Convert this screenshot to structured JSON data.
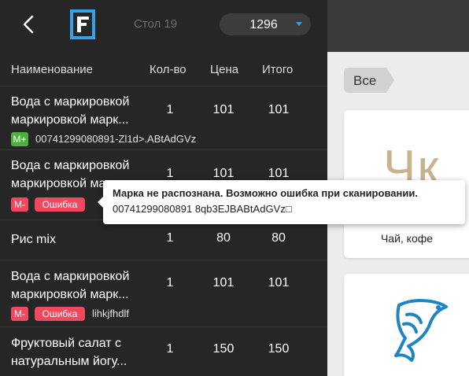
{
  "header": {
    "table_label": "Стол 19",
    "order_number": "1296"
  },
  "columns": {
    "name": "Наименование",
    "qty": "Кол-во",
    "price": "Цена",
    "total": "Итого"
  },
  "items": [
    {
      "name_line1": "Вода с маркировкой",
      "name_line2": "маркировкой марк...",
      "qty": "1",
      "price": "101",
      "total": "101",
      "mark_label": "M+",
      "code": "00741299080891-Zl1d>.ABtAdGVz"
    },
    {
      "name_line1": "Вода с маркировкой",
      "name_line2": "маркировкой марк...",
      "qty": "1",
      "price": "101",
      "total": "101",
      "mark_label": "M-",
      "error_label": "Ошибка"
    },
    {
      "name_line1": "Рис mix",
      "qty": "1",
      "price": "80",
      "total": "80"
    },
    {
      "name_line1": "Вода с маркировкой",
      "name_line2": "маркировкой марк...",
      "qty": "1",
      "price": "101",
      "total": "101",
      "mark_label": "M-",
      "error_label": "Ошибка",
      "code": "lihkjfhdlf"
    },
    {
      "name_line1": "Фруктовый салат с",
      "name_line2": "натуральным йогу...",
      "qty": "1",
      "price": "150",
      "total": "150"
    }
  ],
  "tooltip": {
    "title": "Марка не распознана. Возможно ошибка при сканировании.",
    "code": "00741299080891 8qb3EJBABtAdGVz□"
  },
  "catalog": {
    "category_tab": "Все",
    "cards": [
      {
        "letters": "Чк",
        "label": "Чай, кофе"
      },
      {
        "icon": "fish-icon"
      }
    ]
  },
  "colors": {
    "mark_ok": "#4caf3e",
    "mark_error": "#f0485e",
    "accent": "#35a3e6"
  }
}
